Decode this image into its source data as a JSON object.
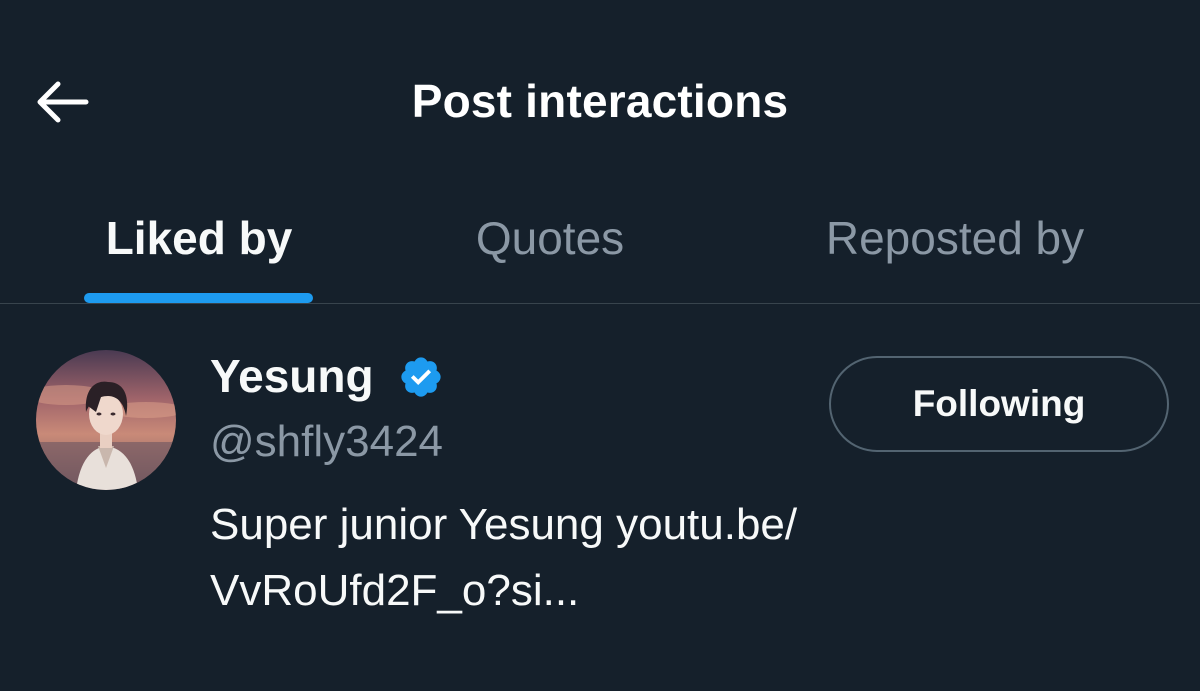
{
  "header": {
    "title": "Post interactions",
    "back_icon": "arrow-left-icon"
  },
  "tabs": [
    {
      "label": "Liked by",
      "active": true
    },
    {
      "label": "Quotes",
      "active": false
    },
    {
      "label": "Reposted by",
      "active": false
    }
  ],
  "users": [
    {
      "name": "Yesung",
      "verified": true,
      "handle": "@shfly3424",
      "bio_lines": [
        "Super junior Yesung youtu.be/",
        "VvRoUfd2F_o?si..."
      ],
      "follow_label": "Following"
    }
  ],
  "colors": {
    "background": "#15202b",
    "accent": "#1d9bf0",
    "text_primary": "#f7f9f9",
    "text_secondary": "#8b98a5",
    "divider": "#38444d"
  }
}
